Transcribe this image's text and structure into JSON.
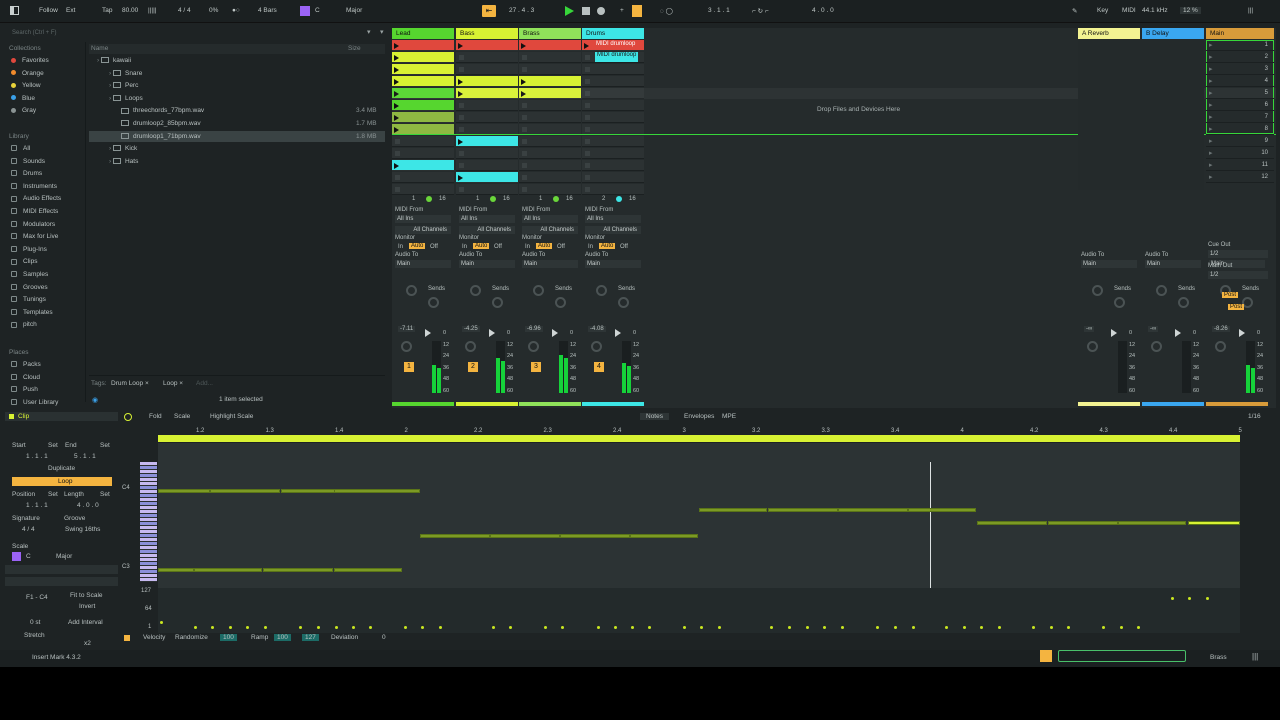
{
  "topbar": {
    "follow": "Follow",
    "ext": "Ext",
    "tap": "Tap",
    "tempo": "80.00",
    "sig": "4 / 4",
    "percent": "0%",
    "bars": "4 Bars",
    "key": "C",
    "scale": "Major",
    "position": "27 .   4 .   3",
    "loop_start": "3 .   1 .   1",
    "loop_len": "4 .   0 .   0",
    "key_label": "Key",
    "midi_label": "MIDI",
    "sample_rate": "44.1 kHz",
    "cpu": "12 %"
  },
  "browser": {
    "search_placeholder": "Search (Ctrl + F)",
    "collections_label": "Collections",
    "collections": [
      {
        "label": "Favorites",
        "color": "#e0483d"
      },
      {
        "label": "Orange",
        "color": "#f08b2c"
      },
      {
        "label": "Yellow",
        "color": "#e8d23a"
      },
      {
        "label": "Blue",
        "color": "#3aa0e8"
      },
      {
        "label": "Gray",
        "color": "#8a9393"
      }
    ],
    "library_label": "Library",
    "library": [
      "All",
      "Sounds",
      "Drums",
      "Instruments",
      "Audio Effects",
      "MIDI Effects",
      "Modulators",
      "Max for Live",
      "Plug-Ins",
      "Clips",
      "Samples",
      "Grooves",
      "Tunings",
      "Templates",
      "pitch"
    ],
    "places_label": "Places",
    "places": [
      "Packs",
      "Cloud",
      "Push",
      "User Library"
    ],
    "col_name": "Name",
    "col_size": "Size",
    "files": [
      {
        "name": "kawaii",
        "size": ""
      },
      {
        "name": "Snare",
        "size": ""
      },
      {
        "name": "Perc",
        "size": ""
      },
      {
        "name": "Loops",
        "size": ""
      },
      {
        "name": "threechords_77bpm.wav",
        "size": "3.4 MB"
      },
      {
        "name": "drumloop2_85bpm.wav",
        "size": "1.7 MB"
      },
      {
        "name": "drumloop1_71bpm.wav",
        "size": "1.8 MB"
      },
      {
        "name": "Kick",
        "size": ""
      },
      {
        "name": "Hats",
        "size": ""
      }
    ],
    "tags_label": "Tags:",
    "tag1": "Drum Loop",
    "tag2": "Loop",
    "tag_add": "Add...",
    "selection": "1 item selected"
  },
  "session": {
    "tracks": [
      {
        "name": "Lead",
        "color": "#56d62f"
      },
      {
        "name": "Bass",
        "color": "#d8f233"
      },
      {
        "name": "Brass",
        "color": "#90e25a"
      },
      {
        "name": "Drums",
        "color": "#3de6e6"
      }
    ],
    "returns": [
      {
        "name": "A Reverb",
        "color": "#f3f392"
      },
      {
        "name": "B Delay",
        "color": "#3aa7f0"
      },
      {
        "name": "Main",
        "color": "#d89b3a"
      }
    ],
    "drums_clip": "MIDI drumloop",
    "drop_text": "Drop Files and Devices Here",
    "scenes": [
      "1",
      "2",
      "3",
      "4",
      "5",
      "6",
      "7",
      "8",
      "9",
      "10",
      "11",
      "12"
    ],
    "mixer": {
      "midi_from": "MIDI From",
      "all_ins": "All Ins",
      "all_channels": "All Channels",
      "monitor": "Monitor",
      "in": "In",
      "auto": "Auto",
      "off": "Off",
      "audio_to": "Audio To",
      "main": "Main",
      "sends": "Sends",
      "cue_out": "Cue Out",
      "cue_val": "1/2",
      "main_out": "Main Out",
      "main_val": "1/2",
      "post": "Post",
      "volumes": [
        "-7.11",
        "-4.25",
        "-6.96",
        "-4.08",
        "-∞",
        "-∞",
        "-8.26"
      ],
      "track_nums": [
        "1",
        "2",
        "3",
        "4"
      ],
      "io_counts": [
        [
          "1",
          "16"
        ],
        [
          "1",
          "16"
        ],
        [
          "1",
          "16"
        ],
        [
          "2",
          "16"
        ]
      ],
      "scale_marks": [
        "0",
        "12",
        "24",
        "36",
        "48",
        "60"
      ]
    }
  },
  "clip": {
    "title": "Clip",
    "fold": "Fold",
    "scale": "Scale",
    "highlight": "Highlight Scale",
    "tabs": [
      "Notes",
      "Envelopes",
      "MPE"
    ],
    "grid": "1/16",
    "start": "Start",
    "set": "Set",
    "end": "End",
    "start_val": "1 .  1 .  1",
    "end_val": "5 .  1 .  1",
    "duplicate": "Duplicate",
    "loop": "Loop",
    "position": "Position",
    "length": "Length",
    "pos_val": "1 .  1 .  1",
    "len_val": "4 .  0 .  0",
    "signature": "Signature",
    "groove": "Groove",
    "sig_val": "4   /   4",
    "swing": "Swing 16ths",
    "scale_label": "Scale",
    "scale_key": "C",
    "scale_mode": "Major",
    "launch": "Launch",
    "pitch_time": "Pitch & Time",
    "range": "F1 - C4",
    "fit": "Fit to Scale",
    "invert": "Invert",
    "transpose": "0 st",
    "add_interval": "Add Interval",
    "stretch": "Stretch",
    "x2": "x2",
    "ruler": [
      "1.2",
      "1.3",
      "1.4",
      "2",
      "2.2",
      "2.3",
      "2.4",
      "3",
      "3.2",
      "3.3",
      "3.4",
      "4",
      "4.2",
      "4.3",
      "4.4",
      "5"
    ],
    "pitch_c4": "C4",
    "pitch_c3": "C3",
    "vel_127": "127",
    "vel_64": "64",
    "vel_1": "1",
    "velocity": "Velocity",
    "randomize": "Randomize",
    "rand_val": "100",
    "ramp": "Ramp",
    "ramp_a": "100",
    "ramp_b": "127",
    "deviation": "Deviation",
    "dev_val": "0"
  },
  "status": {
    "text": "Insert Mark 4.3.2",
    "track": "Brass"
  }
}
